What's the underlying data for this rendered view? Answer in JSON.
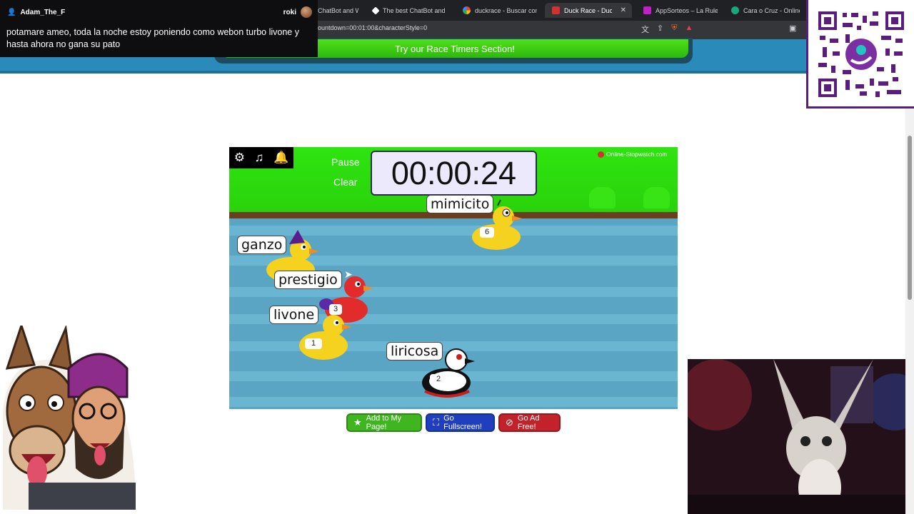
{
  "browser": {
    "tabs": [
      {
        "label": "ChatBot and Wid",
        "active": false
      },
      {
        "label": "The best ChatBot and Wid",
        "active": false
      },
      {
        "label": "duckrace - Buscar con Go",
        "active": false
      },
      {
        "label": "Duck Race - Duck",
        "active": true
      },
      {
        "label": "AppSorteos – La Ruleta de",
        "active": false
      },
      {
        "label": "Cara o Cruz - Online Tira",
        "active": false
      }
    ],
    "url": "ountdown=00:01:00&characterStyle=0"
  },
  "chat": {
    "username": "Adam_The_F",
    "right_name": "roki",
    "message": "potamare ameo, toda la noche estoy poniendo como webon turbo livone y hasta ahora no gana su pato"
  },
  "site": {
    "race_timers_button": "Try our Race Timers Section!"
  },
  "game": {
    "pause_label": "Pause",
    "clear_label": "Clear",
    "timer": "00:00:24",
    "brand": "Online-Stopwatch.com",
    "ducks": [
      {
        "name": "mimicito",
        "number": "6",
        "color": "#f5d21e"
      },
      {
        "name": "ganzo",
        "number": "",
        "color": "#f5d21e"
      },
      {
        "name": "prestigio",
        "number": "3",
        "color": "#e22b2b"
      },
      {
        "name": "livone",
        "number": "1",
        "color": "#f5d21e"
      },
      {
        "name": "liricosa",
        "number": "2",
        "color": "#ffffff"
      }
    ]
  },
  "buttons": {
    "add": "Add to My Page!",
    "fullscreen": "Go Fullscreen!",
    "adfree": "Go Ad Free!"
  },
  "colors": {
    "sky": "#2ad20c",
    "water": "#5aa5c4",
    "add_button": "#3fb51f",
    "fullscreen_button": "#1f3fbf",
    "adfree_button": "#c4222a"
  }
}
